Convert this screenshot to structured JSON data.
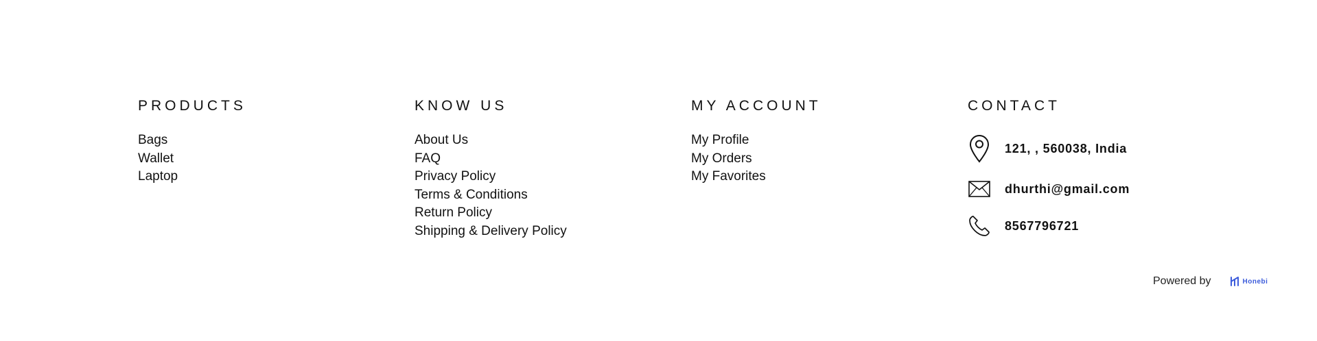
{
  "columns": {
    "products": {
      "title": "PRODUCTS",
      "items": [
        "Bags",
        "Wallet",
        "Laptop"
      ]
    },
    "know_us": {
      "title": "KNOW US",
      "items": [
        "About Us",
        "FAQ",
        "Privacy Policy",
        "Terms & Conditions",
        "Return Policy",
        "Shipping & Delivery Policy"
      ]
    },
    "my_account": {
      "title": "MY ACCOUNT",
      "items": [
        "My Profile",
        "My Orders",
        "My Favorites"
      ]
    },
    "contact": {
      "title": "CONTACT",
      "address": "121, , 560038, India",
      "email": "dhurthi@gmail.com",
      "phone": "8567796721",
      "icons": [
        "location-pin-icon",
        "envelope-icon",
        "phone-icon"
      ]
    }
  },
  "powered_by": {
    "label": "Powered by",
    "brand": "Honebi",
    "brand_color": "#3b5bdb"
  }
}
